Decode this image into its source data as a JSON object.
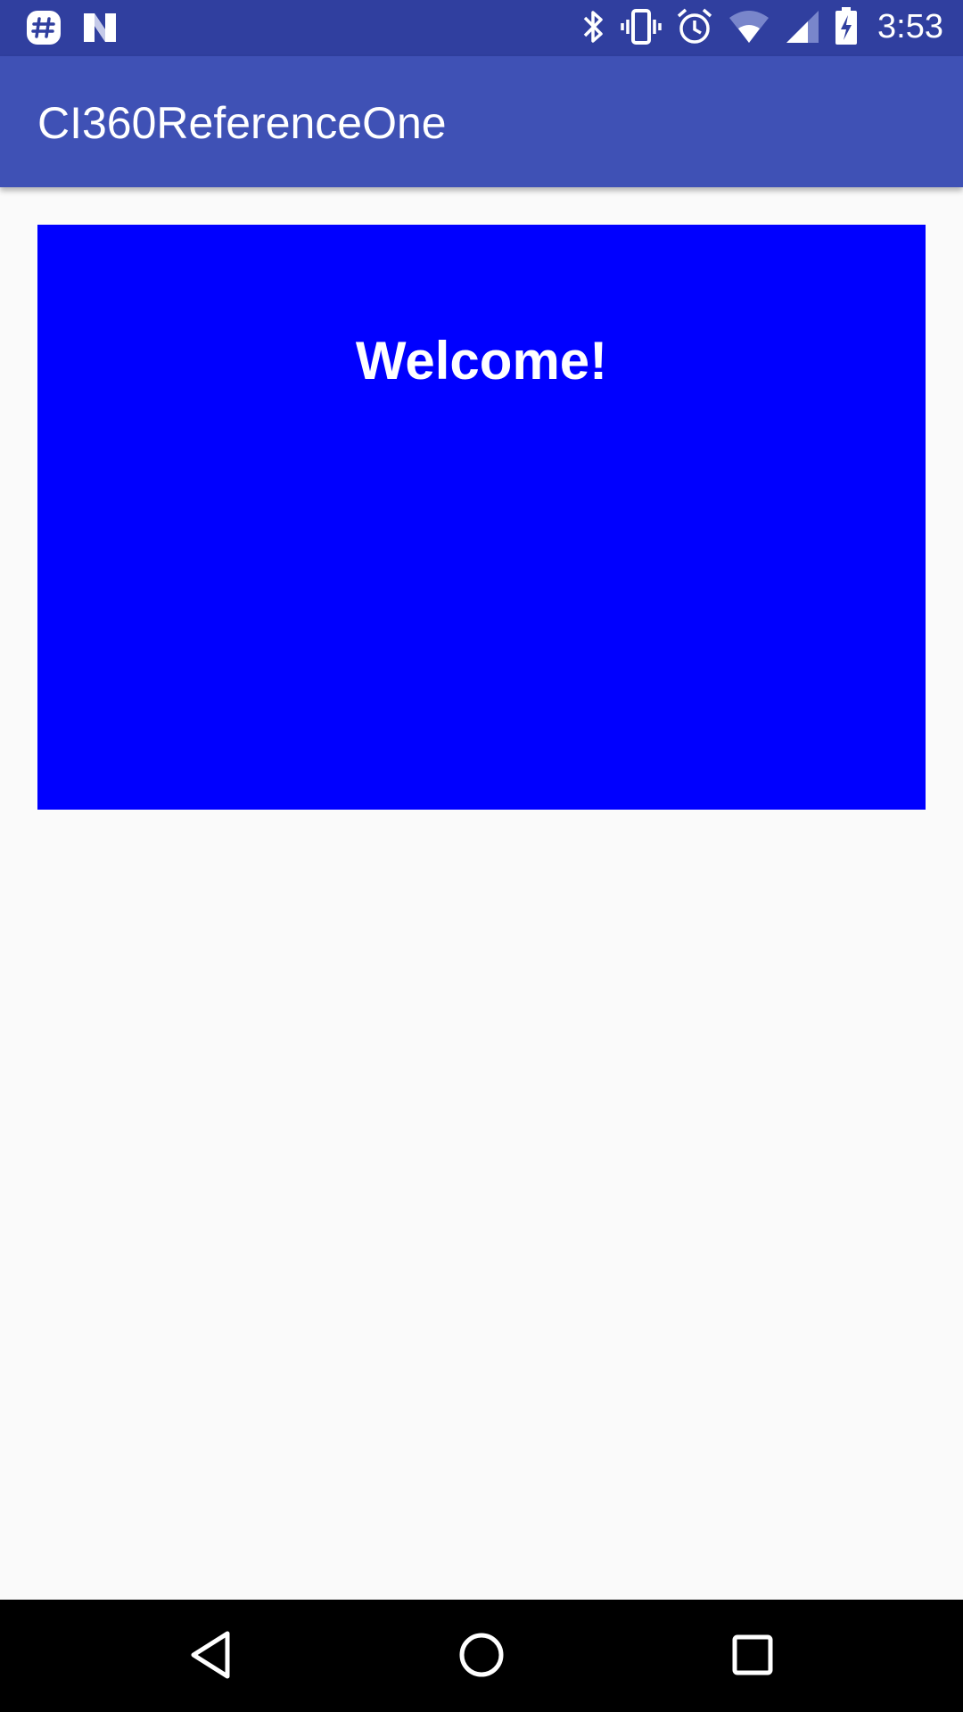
{
  "status_bar": {
    "time": "3:53",
    "left_icons": [
      "slack-icon",
      "n-icon"
    ],
    "right_icons": [
      "bluetooth-icon",
      "vibrate-icon",
      "alarm-icon",
      "wifi-icon",
      "cell-signal-icon",
      "battery-charging-icon"
    ],
    "background": "#303f9f"
  },
  "app_bar": {
    "title": "CI360ReferenceOne",
    "background": "#3f51b5"
  },
  "banner": {
    "title": "Welcome!",
    "background": "#0000ff"
  },
  "nav_bar": {
    "buttons": [
      "back-icon",
      "home-icon",
      "recents-icon"
    ]
  }
}
